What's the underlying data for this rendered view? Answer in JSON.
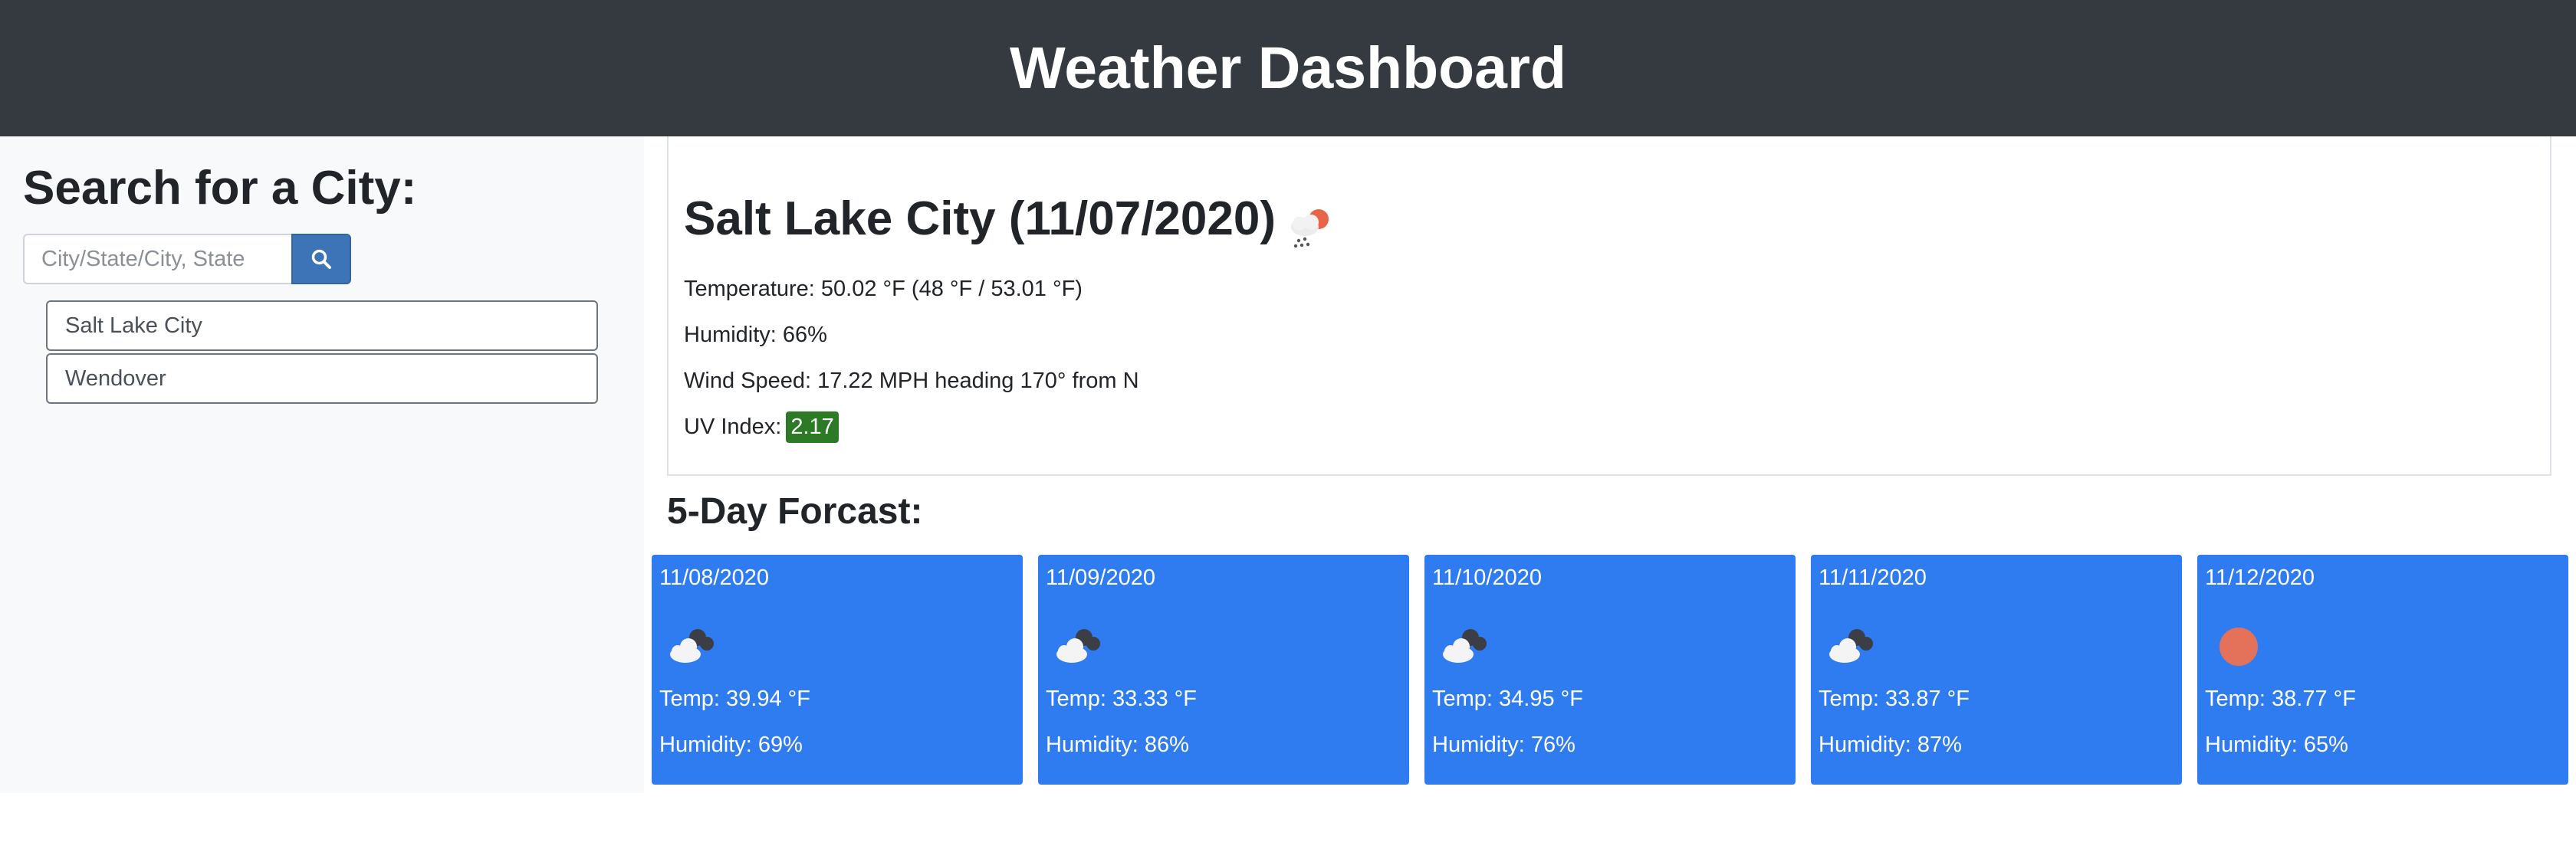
{
  "header": {
    "title": "Weather Dashboard"
  },
  "sidebar": {
    "heading": "Search for a City:",
    "search": {
      "placeholder": "City/State/City, State",
      "value": ""
    },
    "search_icon": "search-icon",
    "history": [
      "Salt Lake City",
      "Wendover"
    ]
  },
  "current": {
    "title": "Salt Lake City (11/07/2020)",
    "icon": "cloud-snow-sun-icon",
    "temperature": "Temperature: 50.02 °F (48 °F / 53.01 °F)",
    "humidity": "Humidity: 66%",
    "wind": "Wind Speed: 17.22 MPH heading 170° from N",
    "uv_label": "UV Index:",
    "uv_value": "2.17",
    "uv_color": "#2d7a26"
  },
  "forecast": {
    "title": "5-Day Forcast:",
    "card_color": "#2f7bf0",
    "days": [
      {
        "date": "11/08/2020",
        "icon": "cloudy-icon",
        "temp": "Temp: 39.94 °F",
        "humidity": "Humidity: 69%"
      },
      {
        "date": "11/09/2020",
        "icon": "cloudy-icon",
        "temp": "Temp: 33.33 °F",
        "humidity": "Humidity: 86%"
      },
      {
        "date": "11/10/2020",
        "icon": "cloudy-icon",
        "temp": "Temp: 34.95 °F",
        "humidity": "Humidity: 76%"
      },
      {
        "date": "11/11/2020",
        "icon": "cloudy-icon",
        "temp": "Temp: 33.87 °F",
        "humidity": "Humidity: 87%"
      },
      {
        "date": "11/12/2020",
        "icon": "sun-icon",
        "temp": "Temp: 38.77 °F",
        "humidity": "Humidity: 65%"
      }
    ]
  }
}
